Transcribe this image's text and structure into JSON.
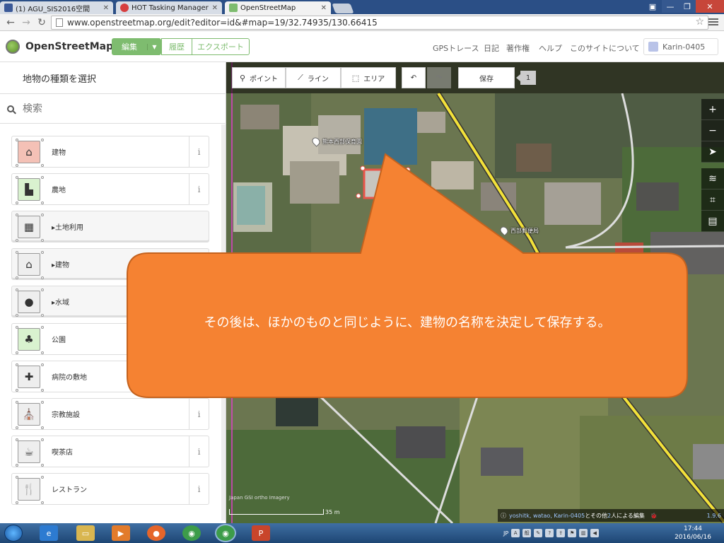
{
  "browser": {
    "tabs": [
      {
        "label": "(1) AGU_SIS2016空間",
        "favicon_color": "#3b5998"
      },
      {
        "label": "HOT Tasking Manager",
        "favicon_color": "#d73f3f"
      },
      {
        "label": "OpenStreetMap",
        "favicon_color": "#7ebc6f"
      }
    ],
    "url": "www.openstreetmap.org/edit?editor=id&#map=19/32.74935/130.66415"
  },
  "osm_header": {
    "site_name": "OpenStreetMap",
    "edit_label": "編集",
    "history_label": "履歴",
    "export_label": "エクスポート",
    "nav": [
      "GPSトレース",
      "日記",
      "著作権",
      "ヘルプ",
      "このサイトについて"
    ],
    "user": "Karin-0405"
  },
  "sidebar": {
    "title": "地物の種類を選択",
    "search_placeholder": "検索",
    "presets": [
      {
        "label": "建物",
        "icon": "building-icon",
        "glyph": "⌂",
        "color": "#f4c1b6",
        "info": "i",
        "category": false
      },
      {
        "label": "農地",
        "icon": "farm-icon",
        "glyph": "▙",
        "color": "#d9f2cf",
        "info": "i",
        "category": false
      },
      {
        "label": "▸土地利用",
        "icon": "landuse-icon",
        "glyph": "▦",
        "color": "#eeeeee",
        "info": "",
        "category": true
      },
      {
        "label": "▸建物",
        "icon": "building-category-icon",
        "glyph": "⌂",
        "color": "#eeeeee",
        "info": "",
        "category": true
      },
      {
        "label": "▸水域",
        "icon": "water-icon",
        "glyph": "●",
        "color": "#eeeeee",
        "info": "",
        "category": true
      },
      {
        "label": "公園",
        "icon": "park-icon",
        "glyph": "♣",
        "color": "#d9f2cf",
        "info": "",
        "category": false
      },
      {
        "label": "病院の敷地",
        "icon": "hospital-icon",
        "glyph": "✚",
        "color": "#eeeeee",
        "info": "",
        "category": false
      },
      {
        "label": "宗教施設",
        "icon": "place-of-worship-icon",
        "glyph": "⛪",
        "color": "#eeeeee",
        "info": "i",
        "category": false
      },
      {
        "label": "喫茶店",
        "icon": "cafe-icon",
        "glyph": "☕",
        "color": "#eeeeee",
        "info": "i",
        "category": false
      },
      {
        "label": "レストラン",
        "icon": "restaurant-icon",
        "glyph": "🍴",
        "color": "#eeeeee",
        "info": "i",
        "category": false
      }
    ]
  },
  "toolbar": {
    "point": "ポイント",
    "line": "ライン",
    "area": "エリア",
    "save": "保存",
    "save_count": "1"
  },
  "map": {
    "poi_1": "熊本西部保育園",
    "poi_2": "西部郵便局",
    "attribution": "Japan GSI ortho Imagery",
    "scale": "35 m",
    "footer_users": "yoshitk, watao, Karin-0405",
    "footer_mid": " とその他 ",
    "footer_count": "2",
    "footer_tail": " 人による編集",
    "version": "1.9.6"
  },
  "callout": {
    "text": "その後は、ほかのものと同じように、建物の名称を決定して保存する。",
    "fill": "#f58232"
  },
  "taskbar": {
    "lang": "JP",
    "time": "17:44",
    "date": "2016/06/16"
  }
}
